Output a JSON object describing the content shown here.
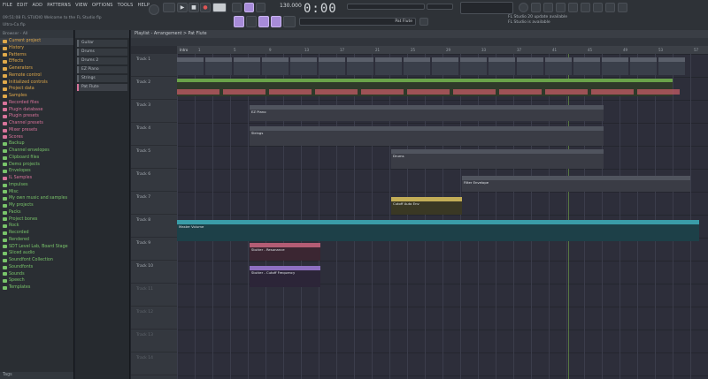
{
  "menu": [
    "FILE",
    "EDIT",
    "ADD",
    "PATTERNS",
    "VIEW",
    "OPTIONS",
    "TOOLS",
    "HELP"
  ],
  "hint_bar": "09:51:08  FL STUDIO Welcome to the FL Studio flp",
  "pattern_label": "Ultra-Ca.flp",
  "transport": {
    "time": "0:00",
    "tempo": "130.000",
    "pattern": "Pat Flute"
  },
  "news": [
    "FL Studio 20 update available",
    "FL Studio is available"
  ],
  "browser": {
    "header": "Browser - All",
    "items": [
      {
        "label": "Current project",
        "color": "#e0a94a"
      },
      {
        "label": "History",
        "color": "#e0a94a"
      },
      {
        "label": "Patterns",
        "color": "#e0a94a"
      },
      {
        "label": "Effects",
        "color": "#e0a94a"
      },
      {
        "label": "Generators",
        "color": "#e0a94a"
      },
      {
        "label": "Remote control",
        "color": "#e0a94a"
      },
      {
        "label": "Initialized controls",
        "color": "#e0a94a"
      },
      {
        "label": "Project data",
        "color": "#e0a94a"
      },
      {
        "label": "Samples",
        "color": "#e0a94a"
      },
      {
        "label": "Recorded files",
        "color": "#d8739a"
      },
      {
        "label": "Plugin database",
        "color": "#d8739a"
      },
      {
        "label": "Plugin presets",
        "color": "#d8739a"
      },
      {
        "label": "Channel presets",
        "color": "#d8739a"
      },
      {
        "label": "Mixer presets",
        "color": "#d8739a"
      },
      {
        "label": "Scores",
        "color": "#d8739a"
      },
      {
        "label": "Backup",
        "color": "#79c46a"
      },
      {
        "label": "Channel envelopes",
        "color": "#79c46a"
      },
      {
        "label": "Clipboard files",
        "color": "#79c46a"
      },
      {
        "label": "Demo projects",
        "color": "#79c46a"
      },
      {
        "label": "Envelopes",
        "color": "#79c46a"
      },
      {
        "label": "IL Samples",
        "color": "#d8739a"
      },
      {
        "label": "Impulses",
        "color": "#79c46a"
      },
      {
        "label": "Misc",
        "color": "#79c46a"
      },
      {
        "label": "My own music and samples",
        "color": "#79c46a"
      },
      {
        "label": "My projects",
        "color": "#79c46a"
      },
      {
        "label": "Packs",
        "color": "#79c46a"
      },
      {
        "label": "Project bones",
        "color": "#79c46a"
      },
      {
        "label": "Rock",
        "color": "#79c46a"
      },
      {
        "label": "Recorded",
        "color": "#79c46a"
      },
      {
        "label": "Rendered",
        "color": "#79c46a"
      },
      {
        "label": "SDT Level Lab, Board Stage",
        "color": "#79c46a"
      },
      {
        "label": "Sliced audio",
        "color": "#79c46a"
      },
      {
        "label": "Soundfont Collection",
        "color": "#79c46a"
      },
      {
        "label": "Soundfonts",
        "color": "#79c46a"
      },
      {
        "label": "Sounds",
        "color": "#79c46a"
      },
      {
        "label": "Speech",
        "color": "#79c46a"
      },
      {
        "label": "Templates",
        "color": "#79c46a"
      }
    ],
    "footer": "Tags"
  },
  "picker": [
    "Guitar",
    "Drums",
    "Drums 2",
    "EZ Piano",
    "Strings",
    "Pat Flute"
  ],
  "playlist": {
    "title": "Playlist - Arrangement > Pat Flute",
    "ruler_label": "Intro",
    "bars": [
      "1",
      "5",
      "9",
      "13",
      "17",
      "21",
      "25",
      "29",
      "33",
      "37",
      "41",
      "45",
      "49",
      "53",
      "57"
    ],
    "tracks": [
      "Track 1",
      "Track 2",
      "Track 3",
      "Track 4",
      "Track 5",
      "Track 6",
      "Track 7",
      "Track 8",
      "Track 9",
      "Track 10",
      "Track 11",
      "Track 12",
      "Track 13",
      "Track 14"
    ],
    "clips": {
      "ez_piano": "EZ Piano",
      "strings": "Strings",
      "drums": "Drums",
      "auto1": "Cutoff Auto Env",
      "auto2": "Filter Envelope",
      "long": "Master Volume",
      "red": "Stutter - Resonance",
      "violet": "Stutter - Cutoff Frequency"
    }
  }
}
